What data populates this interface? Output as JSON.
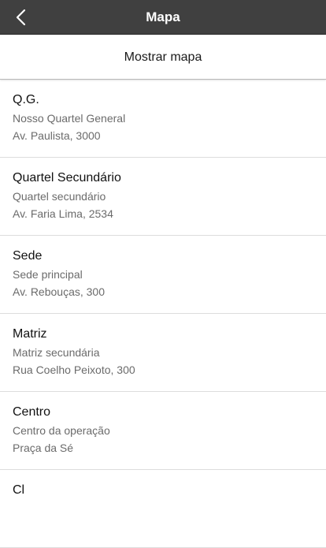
{
  "header": {
    "title": "Mapa",
    "back_icon": "chevron-left-icon"
  },
  "map_bar": {
    "label": "Mostrar mapa"
  },
  "locations": [
    {
      "title": "Q.G.",
      "subtitle": "Nosso Quartel General",
      "address": "Av. Paulista, 3000"
    },
    {
      "title": "Quartel Secundário",
      "subtitle": "Quartel secundário",
      "address": "Av. Faria Lima, 2534"
    },
    {
      "title": "Sede",
      "subtitle": "Sede principal",
      "address": "Av. Rebouças, 300"
    },
    {
      "title": "Matriz",
      "subtitle": "Matriz secundária",
      "address": "Rua Coelho Peixoto, 300"
    },
    {
      "title": "Centro",
      "subtitle": "Centro da operação",
      "address": "Praça da Sé"
    },
    {
      "title": "Cl",
      "subtitle": "",
      "address": ""
    }
  ],
  "colors": {
    "header_bg": "#404040",
    "header_text": "#ffffff",
    "secondary_text": "#6b6b6b"
  }
}
